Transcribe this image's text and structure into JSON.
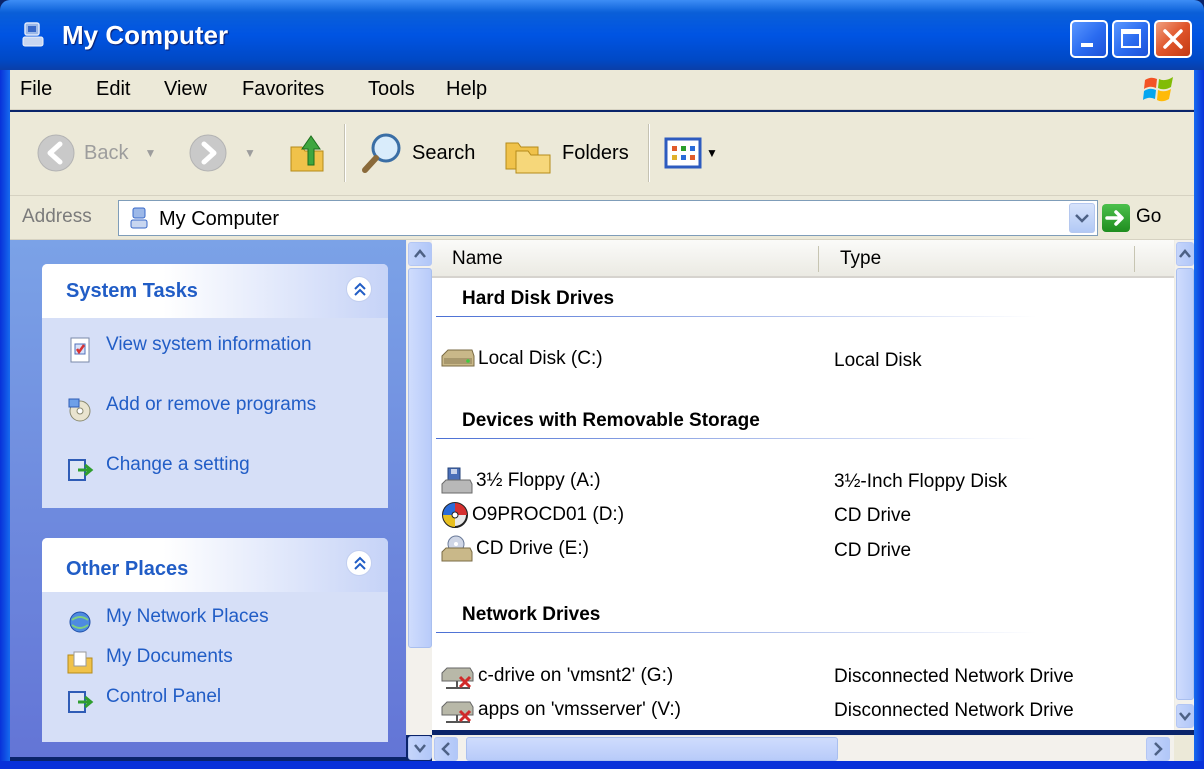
{
  "window": {
    "title": "My Computer"
  },
  "menu": {
    "items": [
      {
        "label": "File"
      },
      {
        "label": "Edit"
      },
      {
        "label": "View"
      },
      {
        "label": "Favorites"
      },
      {
        "label": "Tools"
      },
      {
        "label": "Help"
      }
    ]
  },
  "toolbar": {
    "back_label": "Back",
    "search_label": "Search",
    "folders_label": "Folders"
  },
  "address": {
    "label": "Address",
    "value": "My Computer",
    "go_label": "Go"
  },
  "taskpane": {
    "system_tasks": {
      "title": "System Tasks",
      "items": [
        {
          "label": "View system information",
          "icon": "system-info-icon"
        },
        {
          "label": "Add or remove programs",
          "icon": "add-remove-programs-icon"
        },
        {
          "label": "Change a setting",
          "icon": "control-panel-icon"
        }
      ]
    },
    "other_places": {
      "title": "Other Places",
      "items": [
        {
          "label": "My Network Places",
          "icon": "network-places-icon"
        },
        {
          "label": "My Documents",
          "icon": "documents-folder-icon"
        },
        {
          "label": "Control Panel",
          "icon": "control-panel-icon"
        }
      ]
    }
  },
  "listview": {
    "columns": [
      {
        "label": "Name"
      },
      {
        "label": "Type"
      }
    ],
    "groups": [
      {
        "title": "Hard Disk Drives",
        "rows": [
          {
            "name": "Local Disk (C:)",
            "type": "Local Disk",
            "icon": "hard-disk-icon"
          }
        ]
      },
      {
        "title": "Devices with Removable Storage",
        "rows": [
          {
            "name": "3½ Floppy (A:)",
            "type": "3½-Inch Floppy Disk",
            "icon": "floppy-drive-icon"
          },
          {
            "name": "O9PROCD01 (D:)",
            "type": "CD Drive",
            "icon": "cd-disc-icon"
          },
          {
            "name": "CD Drive (E:)",
            "type": "CD Drive",
            "icon": "cd-drive-icon"
          }
        ]
      },
      {
        "title": "Network Drives",
        "rows": [
          {
            "name": "c-drive on 'vmsnt2' (G:)",
            "type": "Disconnected Network Drive",
            "icon": "disconnected-network-drive-icon"
          },
          {
            "name": "apps on 'vmsserver' (V:)",
            "type": "Disconnected Network Drive",
            "icon": "disconnected-network-drive-icon"
          }
        ]
      }
    ]
  },
  "colors": {
    "title_bar": "#0054e3",
    "task_pane": "#6d8ee0",
    "task_link": "#215dc6",
    "chrome": "#ece9d8"
  }
}
